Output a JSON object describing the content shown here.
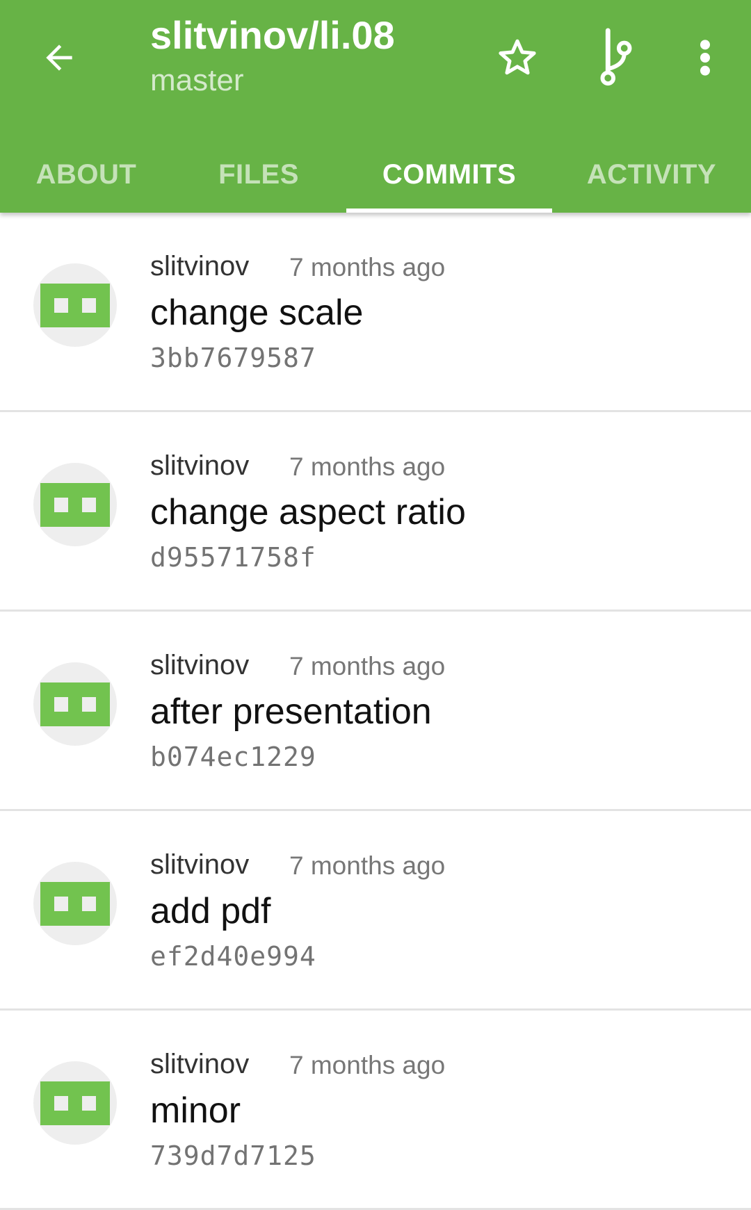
{
  "appbar": {
    "title": "slitvinov/li.08",
    "subtitle": "master",
    "icons": {
      "back": "arrow-left-icon",
      "star": "star-outline-icon",
      "branch": "git-branch-icon",
      "overflow": "more-vertical-icon"
    }
  },
  "tabs": [
    {
      "label": "ABOUT",
      "active": false
    },
    {
      "label": "FILES",
      "active": false
    },
    {
      "label": "COMMITS",
      "active": true
    },
    {
      "label": "ACTIVITY",
      "active": false
    }
  ],
  "commits": [
    {
      "author": "slitvinov",
      "time": "7 months ago",
      "message": "change scale",
      "sha": "3bb7679587"
    },
    {
      "author": "slitvinov",
      "time": "7 months ago",
      "message": "change aspect ratio",
      "sha": "d95571758f"
    },
    {
      "author": "slitvinov",
      "time": "7 months ago",
      "message": "after presentation",
      "sha": "b074ec1229"
    },
    {
      "author": "slitvinov",
      "time": "7 months ago",
      "message": "add pdf",
      "sha": "ef2d40e994"
    },
    {
      "author": "slitvinov",
      "time": "7 months ago",
      "message": "minor",
      "sha": "739d7d7125"
    }
  ],
  "colors": {
    "primary": "#67b346",
    "identicon": "#72c34f",
    "avatar_background": "#eeeeee"
  }
}
